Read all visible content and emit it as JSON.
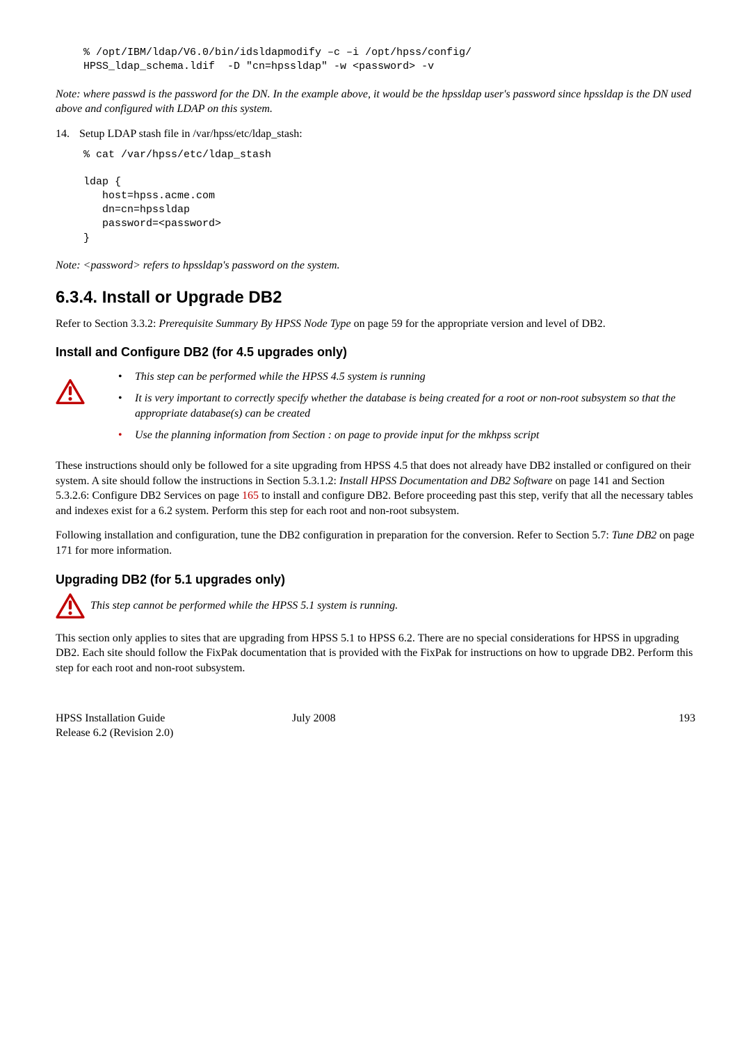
{
  "code_top_l1": "% /opt/IBM/ldap/V6.0/bin/idsldapmodify –c –i /opt/hpss/config/",
  "code_top_l2": "HPSS_ldap_schema.ldif  -D \"cn=hpssldap\" -w <password> -v",
  "p_note1": "Note: where passwd is the password for the DN.  In the example above, it would be the hpssldap user's password since hpssldap is the DN used above and configured with LDAP on this system.",
  "step14_num": "14.",
  "step14_text": "Setup LDAP stash file in /var/hpss/etc/ldap_stash:",
  "code14_l1": "% cat /var/hpss/etc/ldap_stash",
  "code14_l2": "ldap {",
  "code14_l3": "   host=hpss.acme.com",
  "code14_l4": "   dn=cn=hpssldap",
  "code14_l5": "   password=<password>",
  "code14_l6": "}",
  "p_note2": "Note:  <password> refers to hpssldap's password on the system.",
  "h_634": "6.3.4.  Install or Upgrade DB2",
  "p_634_a1": "Refer to Section 3.3.2:  ",
  "p_634_a2": "Prerequisite Summary By HPSS Node Type",
  "p_634_a3": " on page 59 for the appropriate version and level of DB2.",
  "h_install": "Install and Configure DB2 (for 4.5 upgrades only)",
  "b1": "This step can be performed while the HPSS 4.5 system is running",
  "b2": "It is very important to correctly specify whether the database is being created for a root or non-root subsystem so that the appropriate database(s) can be created",
  "b3": "Use the planning information from Section :  on page  to provide input for the mkhpss script",
  "p_install_1a": "These instructions should only be followed for a site upgrading from HPSS 4.5 that does not already have DB2 installed or configured on their system. A site should follow the instructions in Section 5.3.1.2: ",
  "p_install_1b": "Install HPSS Documentation and DB2 Software",
  "p_install_1c": " on page 141 and Section 5.3.2.6: Configure DB2 Services on page  ",
  "p_install_1d": "165",
  "p_install_1e": " to install and configure DB2.   Before proceeding past this step, verify that all the necessary tables and indexes exist for a 6.2 system.  Perform this step for each root and non-root subsystem.",
  "p_install_2a": "Following installation and configuration, tune the DB2 configuration in preparation for the conversion.  Refer to Section 5.7: ",
  "p_install_2b": "Tune DB2",
  "p_install_2c": " on page 171 for more information.",
  "h_upgrading": "Upgrading DB2 (for 5.1 upgrades only)",
  "p_upg_warn": "This step cannot be performed while the HPSS  5.1 system is running.",
  "p_upg_body": "This section only applies to sites that are upgrading from HPSS 5.1 to HPSS 6.2.   There are no special considerations for HPSS in upgrading DB2. Each site should follow the FixPak documentation that is provided with the FixPak for instructions on how to upgrade DB2.    Perform this step for each root and non-root subsystem.",
  "footer_l1": "HPSS Installation Guide",
  "footer_l2": "Release 6.2 (Revision 2.0)",
  "footer_mid": "July 2008",
  "footer_right": "193"
}
